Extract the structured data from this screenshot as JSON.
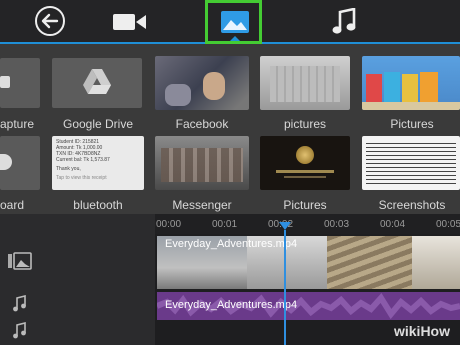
{
  "toolbar": {
    "back": "back-arrow-icon",
    "video": "video-camera-icon",
    "image": "image-icon",
    "music": "music-note-icon"
  },
  "gallery": {
    "row1": [
      "apture",
      "Google Drive",
      "Facebook",
      "pictures",
      "Pictures"
    ],
    "row2": [
      "oard",
      "bluetooth",
      "Messenger",
      "Pictures",
      "Screenshots"
    ]
  },
  "receipt": {
    "l1": "Student ID: 215821",
    "l2": "Amount: Tk 1,000.00",
    "l3": "TXN ID: 4K7BD8NZ",
    "l4": "Current bal: Tk 1,573.87",
    "l5": "Thank you,",
    "l6": "Tap to view this receipt"
  },
  "timeline": {
    "ticks": [
      "00:00",
      "00:01",
      "00:02",
      "00:03",
      "00:04",
      "00:05"
    ],
    "video_clip": "Everyday_Adventures.mp4",
    "audio_clip": "Everyday_Adventures.mp4"
  },
  "watermark": "wikiHow",
  "colors": {
    "accent": "#1f8fd6",
    "highlight": "#44cc33",
    "audio": "#6a3a8a"
  }
}
